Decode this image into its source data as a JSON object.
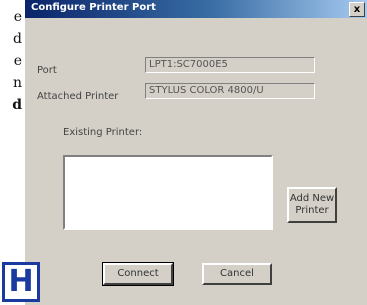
{
  "doc_text": {
    "lines": [
      "e",
      "d",
      "e",
      "n",
      "d"
    ]
  },
  "dialog": {
    "title": "Configure Printer Port",
    "close_label": "x",
    "port_label": "Port",
    "port_value": "LPT1:SC7000E5",
    "attached_label": "Attached Printer",
    "attached_value": "STYLUS COLOR 4800/U",
    "existing_label": "Existing Printer:",
    "add_new_label": "Add New Printer",
    "connect_label": "Connect",
    "cancel_label": "Cancel"
  },
  "badge": {
    "letter": "H"
  }
}
